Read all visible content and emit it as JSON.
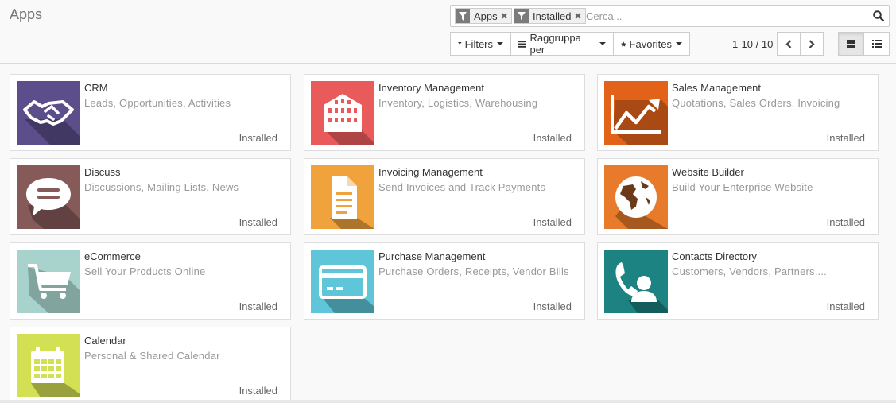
{
  "header": {
    "title": "Apps"
  },
  "search": {
    "facets": [
      {
        "label": "Apps",
        "icon": "filter-icon"
      },
      {
        "label": "Installed",
        "icon": "filter-icon"
      }
    ],
    "placeholder": "Cerca..."
  },
  "toolbar": {
    "filters_label": "Filters",
    "groupby_label": "Raggruppa per",
    "favorites_label": "Favorites"
  },
  "pager": {
    "value": "1-10 / 10"
  },
  "apps": [
    {
      "name": "CRM",
      "summary": "Leads, Opportunities, Activities",
      "status": "Installed",
      "icon": "handshake-icon",
      "color": "#5b4e8a"
    },
    {
      "name": "Inventory Management",
      "summary": "Inventory, Logistics, Warehousing",
      "status": "Installed",
      "icon": "warehouse-icon",
      "color": "#e95b5b"
    },
    {
      "name": "Sales Management",
      "summary": "Quotations, Sales Orders, Invoicing",
      "status": "Installed",
      "icon": "trend-chart-icon",
      "color": "#e2621a"
    },
    {
      "name": "Discuss",
      "summary": "Discussions, Mailing Lists, News",
      "status": "Installed",
      "icon": "chat-bubble-icon",
      "color": "#875a5a"
    },
    {
      "name": "Invoicing Management",
      "summary": "Send Invoices and Track Payments",
      "status": "Installed",
      "icon": "document-icon",
      "color": "#f0a23c"
    },
    {
      "name": "Website Builder",
      "summary": "Build Your Enterprise Website",
      "status": "Installed",
      "icon": "globe-icon",
      "color": "#e87b2b"
    },
    {
      "name": "eCommerce",
      "summary": "Sell Your Products Online",
      "status": "Installed",
      "icon": "shopping-cart-icon",
      "color": "#a7d3cc"
    },
    {
      "name": "Purchase Management",
      "summary": "Purchase Orders, Receipts, Vendor Bills",
      "status": "Installed",
      "icon": "credit-card-icon",
      "color": "#5fc6d9"
    },
    {
      "name": "Contacts Directory",
      "summary": "Customers, Vendors, Partners,...",
      "status": "Installed",
      "icon": "contact-phone-icon",
      "color": "#1c8282"
    },
    {
      "name": "Calendar",
      "summary": "Personal & Shared Calendar",
      "status": "Installed",
      "icon": "calendar-icon",
      "color": "#d4e054"
    }
  ]
}
